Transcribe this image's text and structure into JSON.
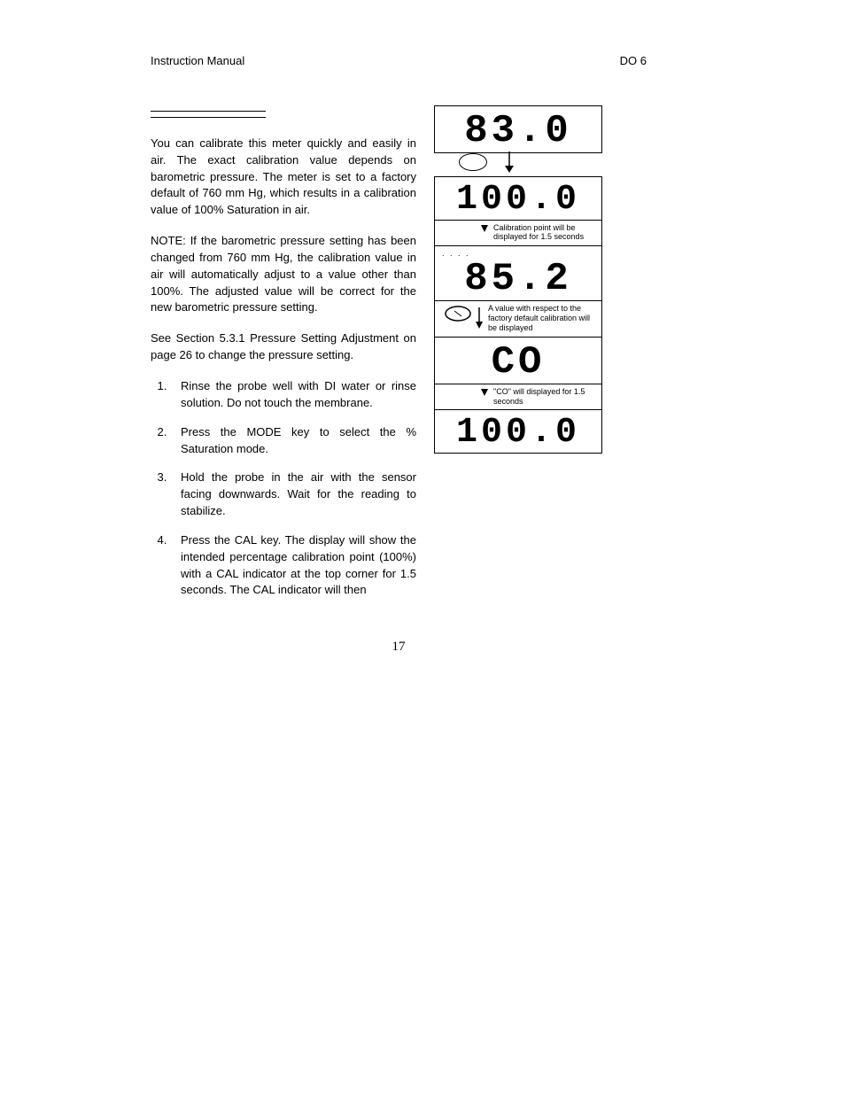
{
  "header": {
    "left": "Instruction Manual",
    "right": "DO 6"
  },
  "intro": {
    "p1": " You can calibrate this meter quickly and easily in air. The exact calibration value depends on barometric pressure. The meter is set to a factory default of 760 mm Hg, which results in a calibration value of 100% Saturation in air.",
    "p2": "NOTE: If the barometric pressure setting has been changed from 760 mm Hg, the calibration value in air will automatically adjust to a value other than 100%. The adjusted value will be correct for the new barometric pressure setting.",
    "p3": "See Section 5.3.1 Pressure Setting Adjustment on page 26 to change the pressure setting."
  },
  "steps": [
    "Rinse the probe well with DI water or rinse solution. Do not touch the membrane.",
    "Press the MODE key to select the % Saturation mode.",
    "Hold the probe in the air with the sensor facing downwards. Wait for the reading to stabilize.",
    "Press the CAL key. The display will show the intended percentage calibration point (100%) with a CAL indicator at the top corner for 1.5 seconds. The CAL indicator will then"
  ],
  "lcd": {
    "v1": "83.0",
    "v2": "100.0",
    "v3": "85.2",
    "v4": "CO",
    "v5": "100.0"
  },
  "annot": {
    "a1": "Calibration point will be displayed for 1.5 seconds",
    "a2": "A value with respect to the factory default calibration will be displayed",
    "a3": "\"CO\" will displayed for 1.5 seconds"
  },
  "page_number": "17"
}
